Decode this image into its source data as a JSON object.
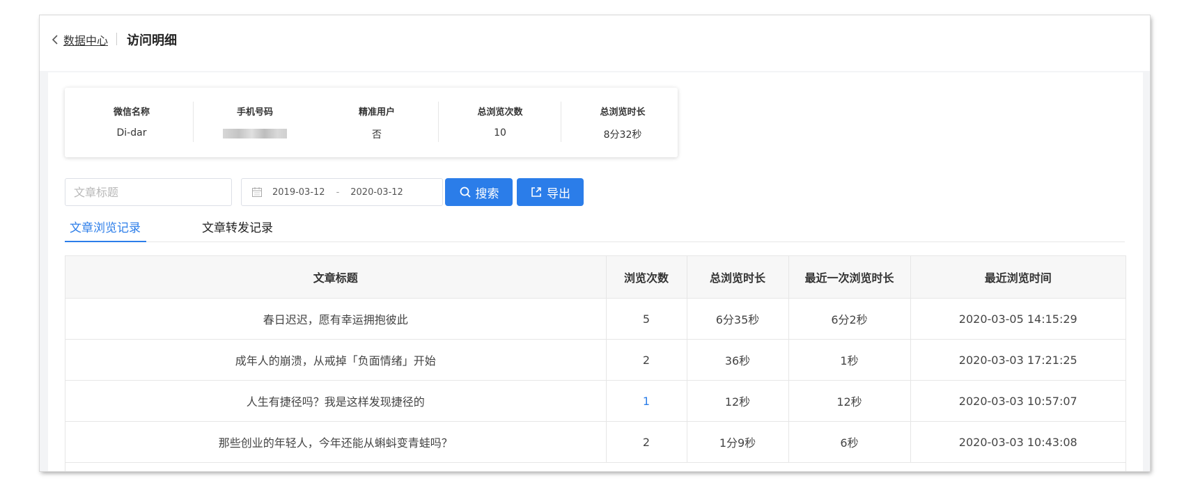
{
  "header": {
    "back_label": "数据中心",
    "title": "访问明细"
  },
  "user_info": [
    {
      "label": "微信名称",
      "value": "Di-dar"
    },
    {
      "label": "手机号码",
      "value": ""
    },
    {
      "label": "精准用户",
      "value": "否"
    },
    {
      "label": "总浏览次数",
      "value": "10"
    },
    {
      "label": "总浏览时长",
      "value": "8分32秒"
    }
  ],
  "filters": {
    "search_placeholder": "文章标题",
    "date_start": "2019-03-12",
    "date_separator": "-",
    "date_end": "2020-03-12",
    "search_button": "搜索",
    "export_button": "导出"
  },
  "tabs": [
    {
      "label": "文章浏览记录",
      "active": true
    },
    {
      "label": "文章转发记录",
      "active": false
    }
  ],
  "table": {
    "columns": [
      "文章标题",
      "浏览次数",
      "总浏览时长",
      "最近一次浏览时长",
      "最近浏览时间"
    ],
    "rows": [
      [
        "春日迟迟，愿有幸运拥抱彼此",
        "5",
        "6分35秒",
        "6分2秒",
        "2020-03-05 14:15:29"
      ],
      [
        "成年人的崩溃，从戒掉「负面情绪」开始",
        "2",
        "36秒",
        "1秒",
        "2020-03-03 17:21:25"
      ],
      [
        "人生有捷径吗？我是这样发现捷径的",
        "1",
        "12秒",
        "12秒",
        "2020-03-03 10:57:07"
      ],
      [
        "那些创业的年轻人，今年还能从蝌蚪变青蛙吗？",
        "2",
        "1分9秒",
        "6秒",
        "2020-03-03 10:43:08"
      ]
    ]
  },
  "colors": {
    "accent": "#2b7de9",
    "page_bg": "#f3f4f6"
  }
}
